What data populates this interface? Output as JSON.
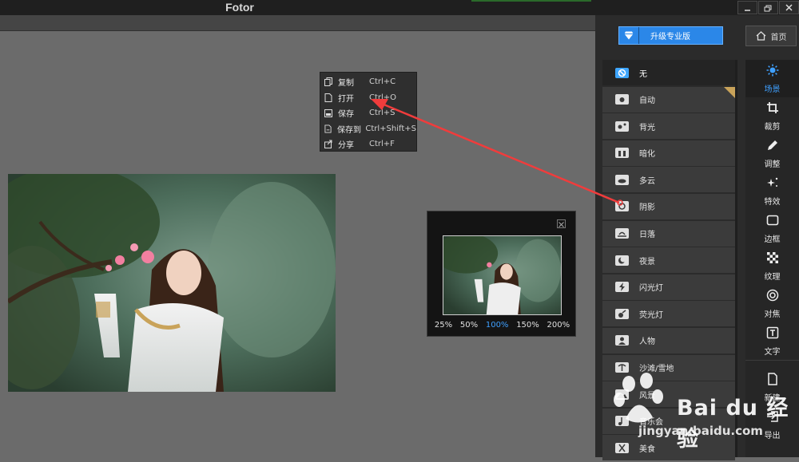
{
  "window": {
    "title": "Fotor"
  },
  "context_menu": {
    "items": [
      {
        "label": "复制",
        "shortcut": "Ctrl+C",
        "icon": "copy-icon"
      },
      {
        "label": "打开",
        "shortcut": "Ctrl+O",
        "icon": "file-icon"
      },
      {
        "label": "保存",
        "shortcut": "Ctrl+S",
        "icon": "save-icon"
      },
      {
        "label": "保存到",
        "shortcut": "Ctrl+Shift+S",
        "icon": "save-as-icon"
      },
      {
        "label": "分享",
        "shortcut": "Ctrl+F",
        "icon": "share-icon"
      }
    ]
  },
  "zoom_panel": {
    "levels": [
      "25%",
      "50%",
      "100%",
      "150%",
      "200%"
    ],
    "active": "100%"
  },
  "header": {
    "upgrade_label": "升级专业版",
    "home_label": "首页"
  },
  "scenes": [
    {
      "label": "无",
      "icon": "none-icon",
      "selected": true
    },
    {
      "label": "自动",
      "icon": "camera-icon",
      "premium": true
    },
    {
      "label": "背光",
      "icon": "backlight-icon"
    },
    {
      "label": "暗化",
      "icon": "darken-icon"
    },
    {
      "label": "多云",
      "icon": "cloud-icon"
    },
    {
      "label": "阴影",
      "icon": "shadow-icon"
    },
    {
      "label": "日落",
      "icon": "sunset-icon"
    },
    {
      "label": "夜景",
      "icon": "moon-icon"
    },
    {
      "label": "闪光灯",
      "icon": "flash-icon"
    },
    {
      "label": "荧光灯",
      "icon": "fluorescent-icon"
    },
    {
      "label": "人物",
      "icon": "portrait-icon"
    },
    {
      "label": "沙滩/雪地",
      "icon": "beach-icon"
    },
    {
      "label": "风景",
      "icon": "landscape-icon"
    },
    {
      "label": "音乐会",
      "icon": "music-icon"
    },
    {
      "label": "美食",
      "icon": "food-icon"
    }
  ],
  "tools": [
    {
      "label": "场景",
      "icon": "sun-icon",
      "selected": true
    },
    {
      "label": "裁剪",
      "icon": "crop-icon"
    },
    {
      "label": "调整",
      "icon": "pencil-icon"
    },
    {
      "label": "特效",
      "icon": "sparkle-icon"
    },
    {
      "label": "边框",
      "icon": "frame-icon"
    },
    {
      "label": "纹理",
      "icon": "texture-icon"
    },
    {
      "label": "对焦",
      "icon": "focus-icon"
    },
    {
      "label": "文字",
      "icon": "text-icon"
    }
  ],
  "file_tools": [
    {
      "label": "新建",
      "icon": "new-file-icon"
    },
    {
      "label": "导出",
      "icon": "export-icon"
    }
  ],
  "watermark": {
    "text": "Bai du 经验",
    "url": "jingyan.baidu.com"
  },
  "colors": {
    "accent": "#3fa0ff",
    "upgrade": "#2b87e8",
    "arrow": "#f03c3c"
  }
}
